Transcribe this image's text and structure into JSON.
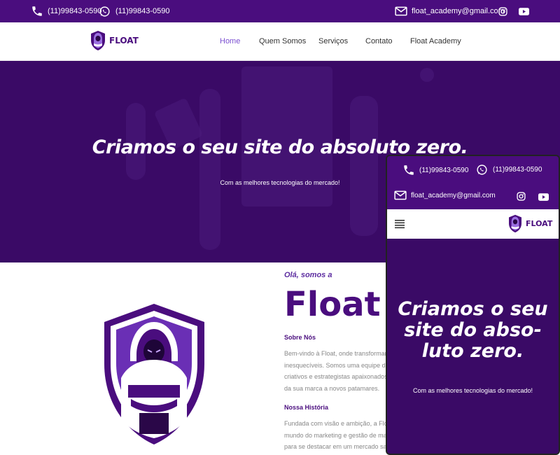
{
  "topbar": {
    "phone": "(11)99843-0590",
    "whatsapp": "(11)99843-0590",
    "email": "float_academy@gmail.com"
  },
  "brand": {
    "name": "FLOAT"
  },
  "nav": {
    "items": [
      {
        "label": "Home"
      },
      {
        "label": "Quem Somos"
      },
      {
        "label": "Serviços"
      },
      {
        "label": "Contato"
      },
      {
        "label": "Float Academy"
      }
    ]
  },
  "hero": {
    "title": "Criamos o seu site do absoluto zero.",
    "subtitle": "Com as melhores tecnologias do mercado!"
  },
  "about": {
    "greeting": "Olá, somos a",
    "brand": "Float",
    "about_heading": "Sobre Nós",
    "about_lines": [
      "Bem-vindo à Float, onde transformam",
      "inesquecíveis. Somos uma equipe de",
      "criativos e estrategistas apaixonados",
      "da sua marca a novos patamares."
    ],
    "history_heading": "Nossa História",
    "history_lines": [
      "Fundada com visão e ambição, a Floa",
      "mundo do marketing e gestão de ma",
      "para se destacar em um mercado sat"
    ]
  },
  "mobile": {
    "phone": "(11)99843-0590",
    "whatsapp": "(11)99843-0590",
    "email": "float_academy@gmail.com",
    "brand": "FLOAT",
    "title_lines": [
      "Criamos o seu",
      "site do abso-",
      "luto zero."
    ],
    "subtitle": "Com as melhores tecnologias do mercado!"
  },
  "icons": [
    "phone-icon",
    "whatsapp-icon",
    "mail-icon",
    "instagram-icon",
    "youtube-icon",
    "hamburger-menu-icon",
    "hooded-mascot-logo"
  ],
  "colors": {
    "primary": "#4a0d7e",
    "hero_bg": "#3a0a66",
    "active_link": "#7b4fd1",
    "accent": "#5c2ca0"
  }
}
